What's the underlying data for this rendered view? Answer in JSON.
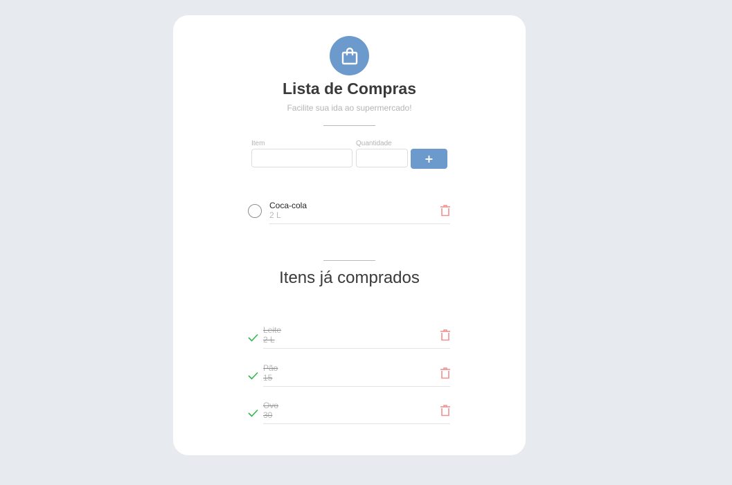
{
  "app": {
    "title": "Lista de Compras",
    "subtitle": "Facilite sua ida ao supermercado!",
    "logo_icon": "shopping-bag-icon"
  },
  "form": {
    "item_label": "Item",
    "item_value": "",
    "quantity_label": "Quantidade",
    "quantity_value": "",
    "add_label": "+"
  },
  "pending": {
    "items": [
      {
        "name": "Coca-cola",
        "qty": "2 L",
        "status_icon": "unchecked-circle-icon",
        "action_icon": "trash-icon"
      }
    ]
  },
  "purchased": {
    "title": "Itens já comprados",
    "items": [
      {
        "name": "Leite",
        "qty": "2 L",
        "status_icon": "check-icon",
        "action_icon": "trash-icon"
      },
      {
        "name": "Pão",
        "qty": "15",
        "status_icon": "check-icon",
        "action_icon": "trash-icon"
      },
      {
        "name": "Ovo",
        "qty": "30",
        "status_icon": "check-icon",
        "action_icon": "trash-icon"
      }
    ]
  },
  "colors": {
    "background": "#e7eaef",
    "card": "#ffffff",
    "accent": "#6d9acc",
    "delete": "#f08f8f",
    "check": "#2eb84b",
    "title": "#3a3a3a",
    "muted": "#b8b8b8"
  }
}
